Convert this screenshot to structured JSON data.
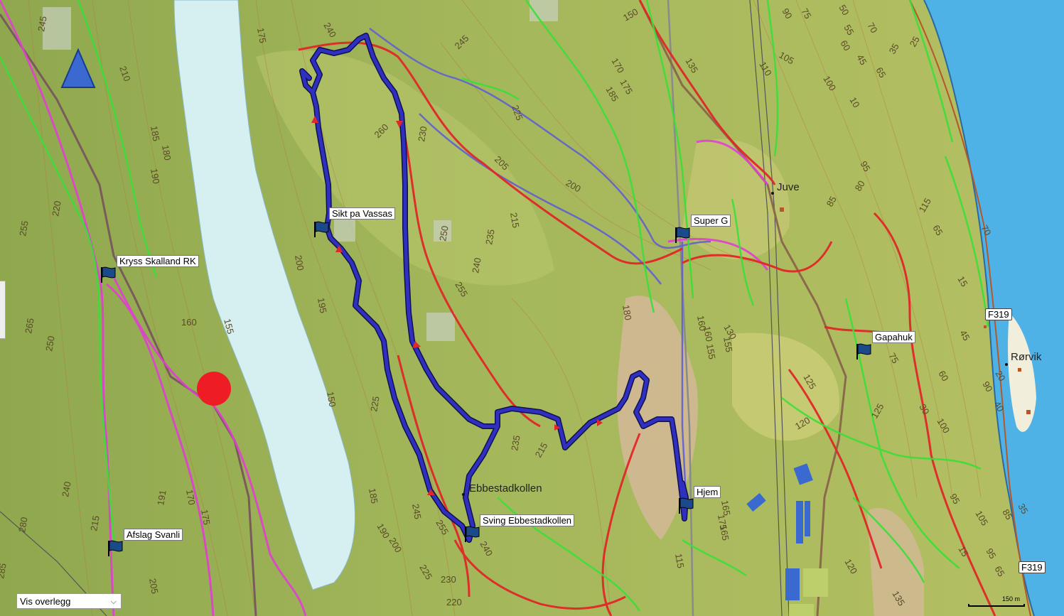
{
  "map": {
    "waypoints": [
      {
        "label": "Sikt pa Vassas"
      },
      {
        "label": "Kryss Skalland RK"
      },
      {
        "label": "Super G"
      },
      {
        "label": "Gapahuk"
      },
      {
        "label": "Hjem"
      },
      {
        "label": "Sving Ebbestadkollen"
      },
      {
        "label": "Afslag Svanli"
      }
    ],
    "places": [
      {
        "name": "Juve"
      },
      {
        "name": "Rørvik"
      },
      {
        "name": "Ebbestadkollen"
      }
    ],
    "road_signs": [
      "F319",
      "F319"
    ],
    "contour_labels": [
      "245",
      "210",
      "185",
      "180",
      "190",
      "220",
      "255",
      "265",
      "250",
      "160",
      "155",
      "240",
      "280",
      "285",
      "215",
      "170",
      "175",
      "191",
      "205",
      "175",
      "240",
      "200",
      "195",
      "150",
      "225",
      "185",
      "190",
      "200",
      "225",
      "230",
      "220",
      "255",
      "245",
      "240",
      "260",
      "230",
      "245",
      "250",
      "235",
      "255",
      "240",
      "225",
      "215",
      "205",
      "200",
      "235",
      "215",
      "180",
      "150",
      "170",
      "175",
      "185",
      "165",
      "160",
      "155",
      "130",
      "125",
      "120",
      "135",
      "110",
      "105",
      "100",
      "90",
      "75",
      "50",
      "55",
      "60",
      "70",
      "45",
      "65",
      "35",
      "25",
      "10",
      "80",
      "95",
      "85",
      "115",
      "65",
      "70",
      "15",
      "45",
      "60",
      "90",
      "20",
      "40",
      "30",
      "100",
      "95",
      "105",
      "85",
      "35",
      "15",
      "95",
      "65",
      "75",
      "125",
      "120",
      "135",
      "115",
      "175",
      "155",
      "160",
      "165"
    ],
    "colors": {
      "lake": "#d6f0f2",
      "sea": "#4fb2e6",
      "terrain": "#9fb35a",
      "track": "#3030c0",
      "track_outline": "#101050",
      "red_trail": "#e02828",
      "green_trail": "#38e038",
      "magenta_trail": "#e040d0",
      "position_marker": "#ee1c24"
    }
  },
  "ui": {
    "overlay_select": {
      "value": "Vis overlegg"
    },
    "scale": {
      "label": "150 m"
    }
  }
}
